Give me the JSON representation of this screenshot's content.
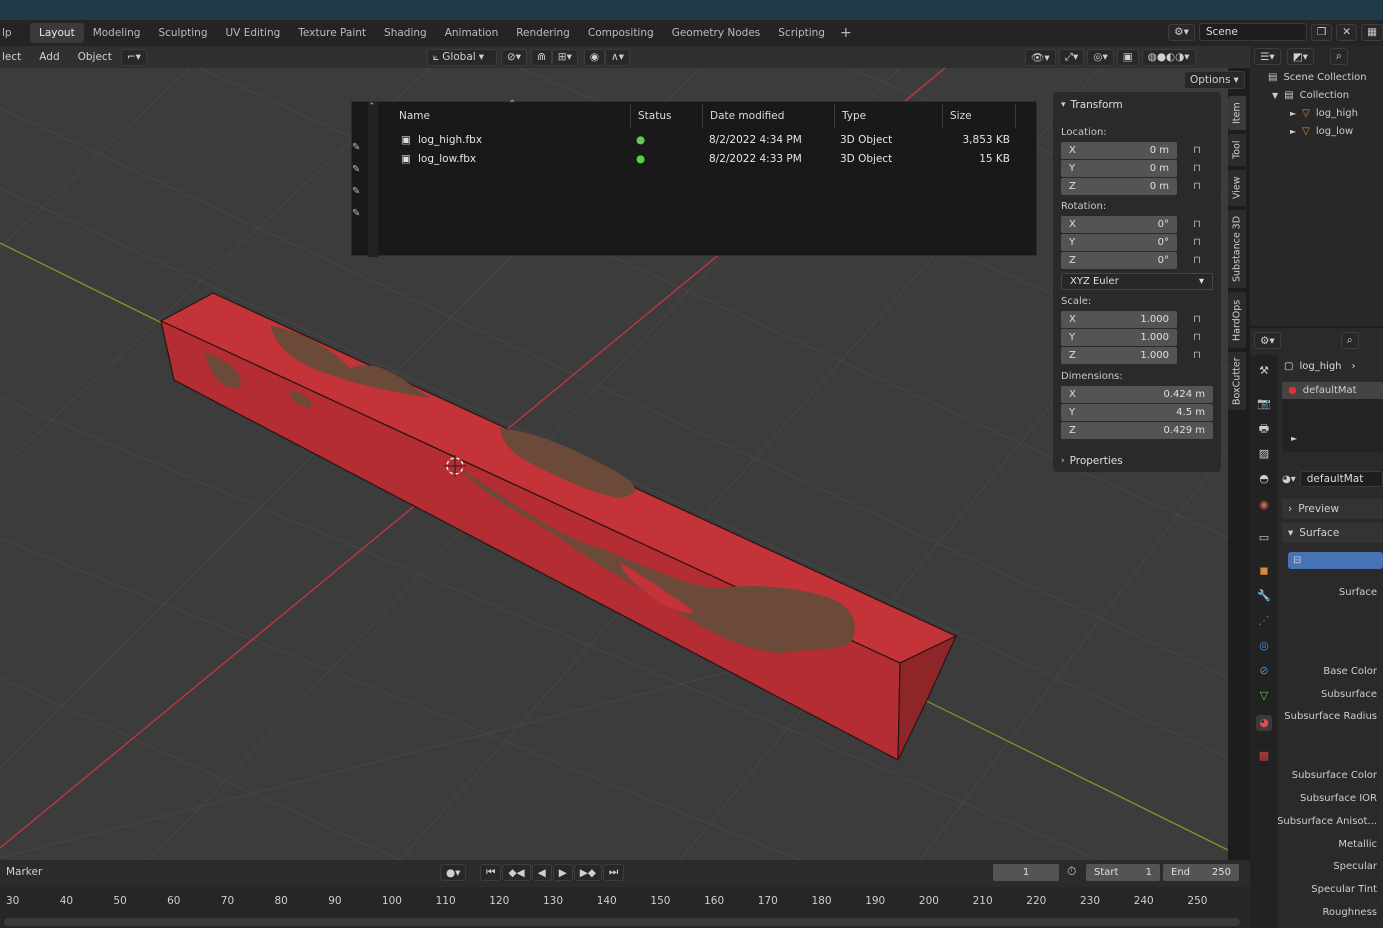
{
  "workspaces": {
    "partial": "lp",
    "items": [
      "Layout",
      "Modeling",
      "Sculpting",
      "UV Editing",
      "Texture Paint",
      "Shading",
      "Animation",
      "Rendering",
      "Compositing",
      "Geometry Nodes",
      "Scripting"
    ],
    "active": "Layout",
    "add": "+"
  },
  "scene": {
    "name": "Scene"
  },
  "header": {
    "menus": [
      "lect",
      "Add",
      "Object"
    ],
    "transform_orientation": "Global",
    "options": "Options"
  },
  "file_browser": {
    "columns": [
      "Name",
      "Status",
      "Date modified",
      "Type",
      "Size"
    ],
    "rows": [
      {
        "name": "log_high.fbx",
        "date": "8/2/2022 4:34 PM",
        "type": "3D Object",
        "size": "3,853 KB"
      },
      {
        "name": "log_low.fbx",
        "date": "8/2/2022 4:33 PM",
        "type": "3D Object",
        "size": "15 KB"
      }
    ]
  },
  "transform": {
    "title": "Transform",
    "location_label": "Location:",
    "location": [
      {
        "axis": "X",
        "value": "0 m"
      },
      {
        "axis": "Y",
        "value": "0 m"
      },
      {
        "axis": "Z",
        "value": "0 m"
      }
    ],
    "rotation_label": "Rotation:",
    "rotation": [
      {
        "axis": "X",
        "value": "0°"
      },
      {
        "axis": "Y",
        "value": "0°"
      },
      {
        "axis": "Z",
        "value": "0°"
      }
    ],
    "rotation_mode": "XYZ Euler",
    "scale_label": "Scale:",
    "scale": [
      {
        "axis": "X",
        "value": "1.000"
      },
      {
        "axis": "Y",
        "value": "1.000"
      },
      {
        "axis": "Z",
        "value": "1.000"
      }
    ],
    "dimensions_label": "Dimensions:",
    "dimensions": [
      {
        "axis": "X",
        "value": "0.424 m"
      },
      {
        "axis": "Y",
        "value": "4.5 m"
      },
      {
        "axis": "Z",
        "value": "0.429 m"
      }
    ],
    "properties": "Properties"
  },
  "side_tabs": [
    "Item",
    "Tool",
    "View",
    "Substance 3D",
    "HardOps",
    "BoxCutter"
  ],
  "outliner": {
    "scene_collection": "Scene Collection",
    "collection": "Collection",
    "objects": [
      "log_high",
      "log_low"
    ]
  },
  "properties": {
    "object": "log_high",
    "material_slot": "defaultMat",
    "material": "defaultMat",
    "panels": [
      "Preview",
      "Surface"
    ],
    "surface_label": "Surface",
    "inputs": [
      "Base Color",
      "Subsurface",
      "Subsurface Radius",
      "Subsurface Color",
      "Subsurface IOR",
      "Subsurface Anisot...",
      "Metallic",
      "Specular",
      "Specular Tint",
      "Roughness"
    ]
  },
  "timeline": {
    "marker": "Marker",
    "current_frame": "1",
    "start_label": "Start",
    "start": "1",
    "end_label": "End",
    "end": "250",
    "ticks": [
      "30",
      "40",
      "50",
      "60",
      "70",
      "80",
      "90",
      "100",
      "110",
      "120",
      "130",
      "140",
      "150",
      "160",
      "170",
      "180",
      "190",
      "200",
      "210",
      "220",
      "230",
      "240",
      "250"
    ]
  },
  "colors": {
    "log_red": "#c9343a",
    "log_bark": "#6b4a3a",
    "x_axis": "#c8363c",
    "y_axis": "#7a9a28",
    "header_blue": "#203a47"
  }
}
